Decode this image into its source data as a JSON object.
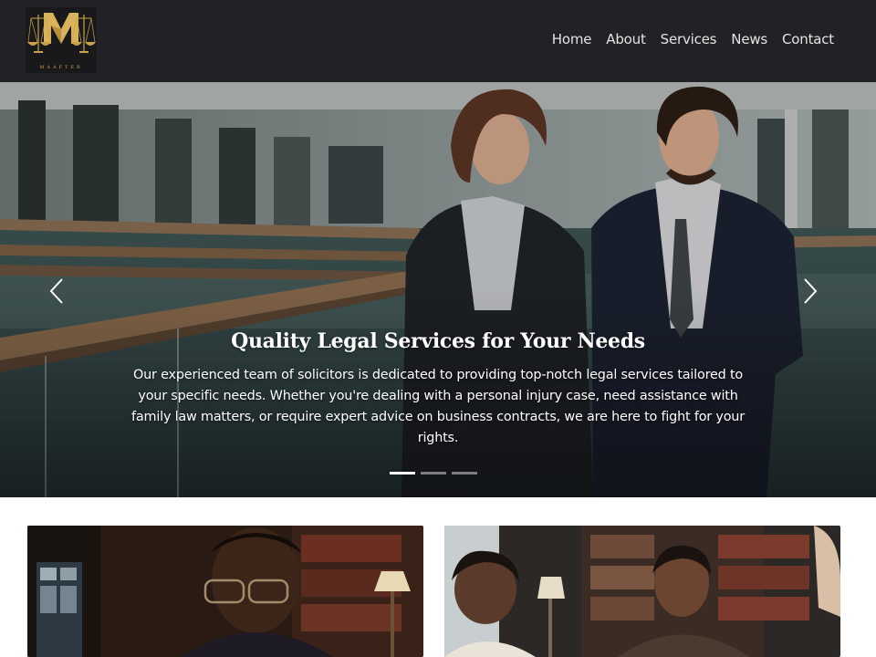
{
  "brand": {
    "name": "MAAFTER",
    "logo_icon": "scales-of-justice-icon"
  },
  "nav": {
    "items": [
      {
        "label": "Home"
      },
      {
        "label": "About"
      },
      {
        "label": "Services"
      },
      {
        "label": "News"
      },
      {
        "label": "Contact"
      }
    ]
  },
  "hero": {
    "title": "Quality Legal Services for Your Needs",
    "description": "Our experienced team of solicitors is dedicated to providing top-notch legal services tailored to your specific needs. Whether you're dealing with a personal injury case, need assistance with family law matters, or require expert advice on business contracts, we are here to fight for your rights.",
    "prev_icon": "chevron-left-icon",
    "next_icon": "chevron-right-icon",
    "slides_count": 3,
    "active_slide": 1
  },
  "cards": [
    {
      "image": "lawyer-reading-in-library-photo"
    },
    {
      "image": "legal-team-meeting-photo"
    }
  ],
  "colors": {
    "navbar_bg": "#222226",
    "brand_gold": "#c9a24a",
    "nav_text": "#e4e4e4"
  }
}
